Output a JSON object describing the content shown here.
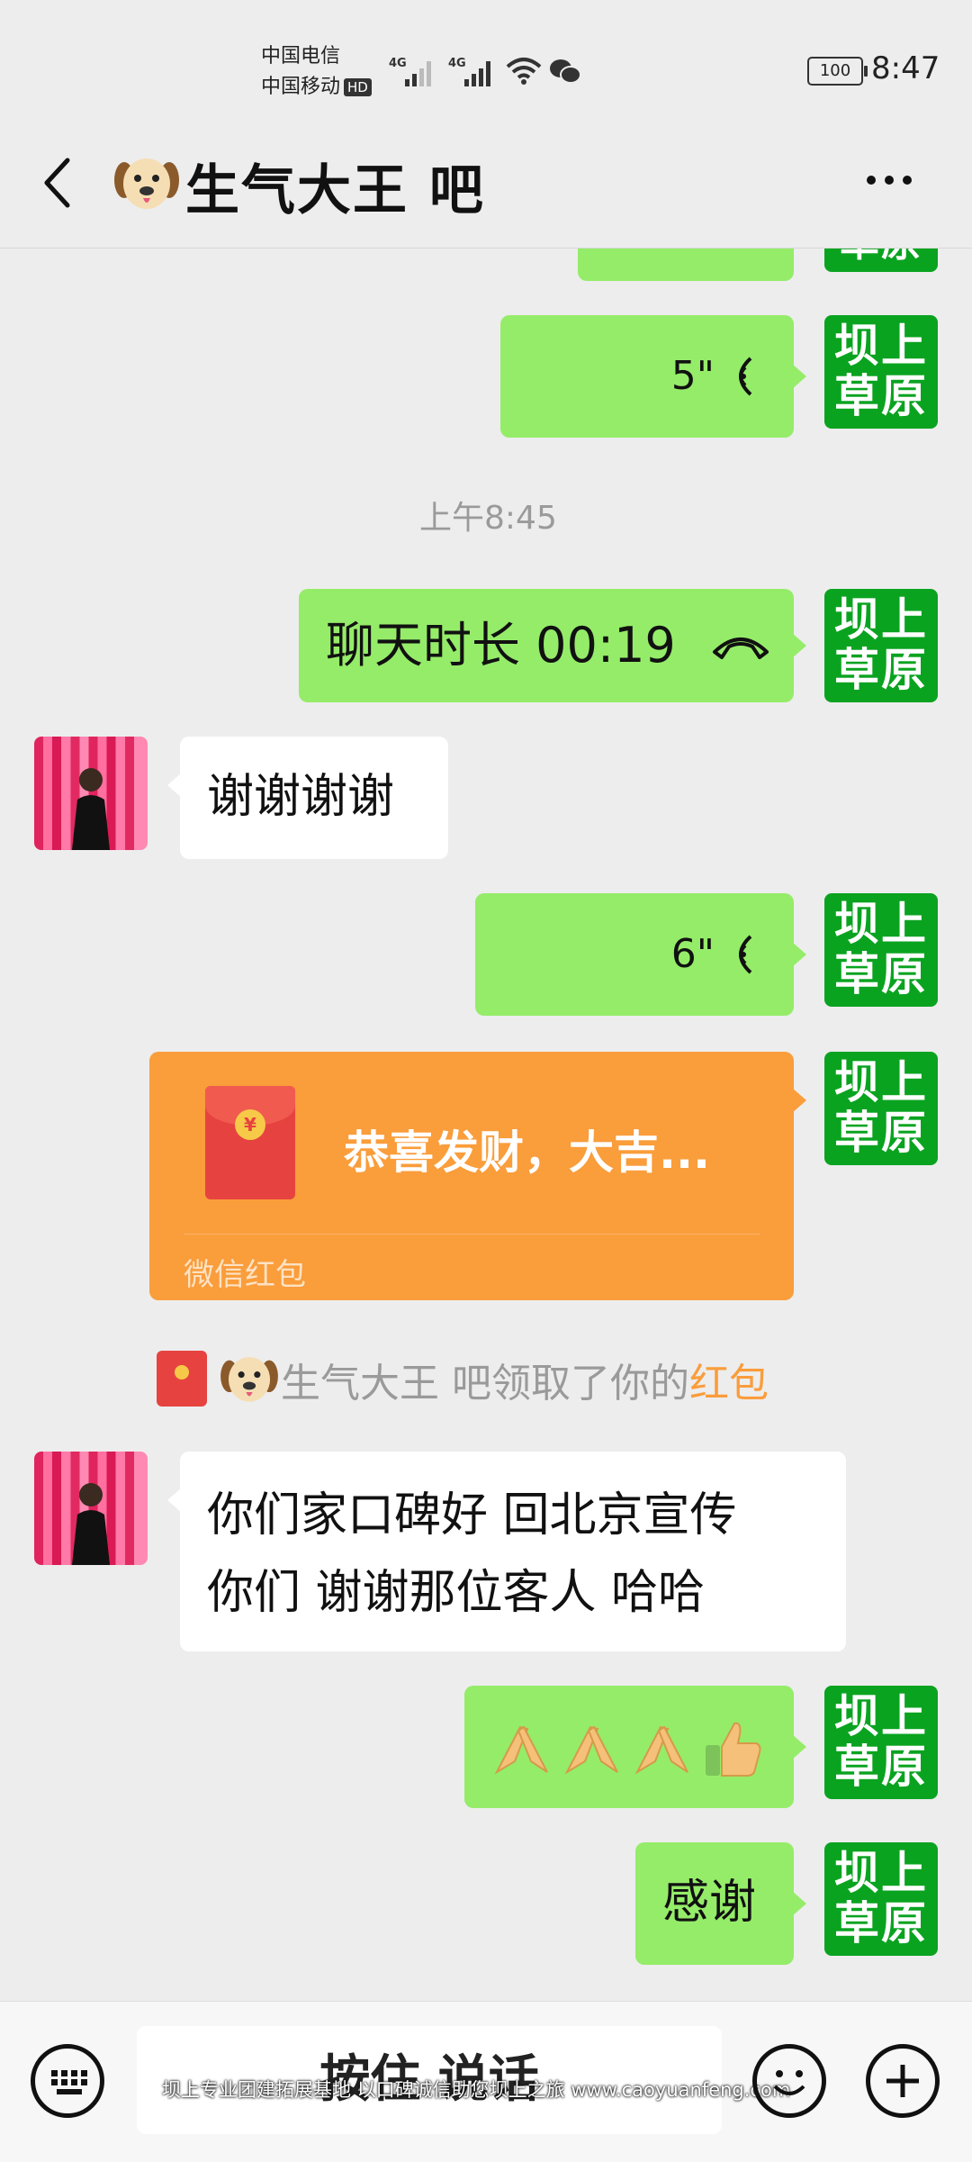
{
  "status_bar": {
    "carrier1": "中国电信",
    "carrier2": "中国移动",
    "hd": "HD",
    "net1": "4G",
    "net2": "4G",
    "battery": "100",
    "time": "8:47"
  },
  "header": {
    "title": "生气大王 吧",
    "back_icon": "chevron-left-icon",
    "more_icon": "more-icon"
  },
  "chat": {
    "top_partial_avatar": "草原",
    "me_avatar_line1": "坝上",
    "me_avatar_line2": "草原",
    "voice1": "5\"",
    "timestamp": "上午8:45",
    "call_text": "聊天时长 00:19",
    "reply1": "谢谢谢谢",
    "voice2": "6\"",
    "red_packet_title": "恭喜发财，大吉...",
    "red_packet_footer": "微信红包",
    "notice_name": "生气大王 吧",
    "notice_text": "领取了你的",
    "notice_link": "红包",
    "reply2_line1": "你们家口碑好 回北京宣传",
    "reply2_line2": "你们 谢谢那位客人 哈哈",
    "thanks": "感谢"
  },
  "bottom_bar": {
    "talk_label": "按住 说话",
    "watermark": "坝上专业团建拓展基地 以口碑诚信助您坝上之旅 www.caoyuanfeng.com",
    "keyboard_icon": "keyboard-icon",
    "emoji_icon": "emoji-icon",
    "plus_icon": "plus-icon"
  },
  "colors": {
    "green_bubble": "#95ec69",
    "avatar_green": "#0aa320",
    "red_packet": "#fa9d3b",
    "background": "#ededed"
  }
}
